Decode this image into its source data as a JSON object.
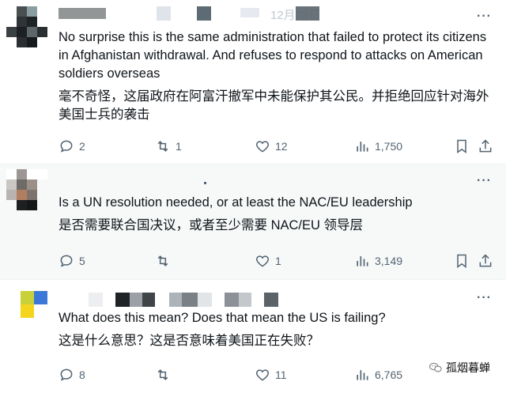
{
  "tweets": [
    {
      "header_fragment": "12月28日",
      "more_label": "···",
      "text_en": "No surprise this is the same administration that failed to protect its citizens in Afghanistan withdrawal. And refuses to respond to attacks on American soldiers overseas",
      "text_zh": "毫不奇怪，这届政府在阿富汗撤军中未能保护其公民。并拒绝回应针对海外美国士兵的袭击",
      "replies": "2",
      "reposts": "1",
      "likes": "12",
      "views": "1,750"
    },
    {
      "more_label": "···",
      "text_en": "Is a UN resolution needed, or at least the NAC/EU leadership",
      "text_zh": "是否需要联合国决议，或者至少需要 NAC/EU 领导层",
      "replies": "5",
      "reposts": "",
      "likes": "1",
      "views": "3,149"
    },
    {
      "more_label": "···",
      "text_en": "What does this mean? Does that mean the US is failing?",
      "text_zh": "这是什么意思？这是否意味着美国正在失败？",
      "replies": "8",
      "reposts": "",
      "likes": "11",
      "views": "6,765"
    }
  ],
  "watermark": {
    "text": "孤烟暮蝉"
  },
  "icons": {
    "reply": "reply-icon",
    "repost": "repost-icon",
    "like": "heart-icon",
    "views": "views-chart-icon",
    "bookmark": "bookmark-icon",
    "share": "share-icon",
    "more": "more-icon",
    "watermark": "wechat-logo-icon"
  },
  "colors": {
    "text": "#0f1419",
    "muted": "#536471",
    "divider": "#eff3f4",
    "highlight_bg": "#f7f9f9"
  }
}
